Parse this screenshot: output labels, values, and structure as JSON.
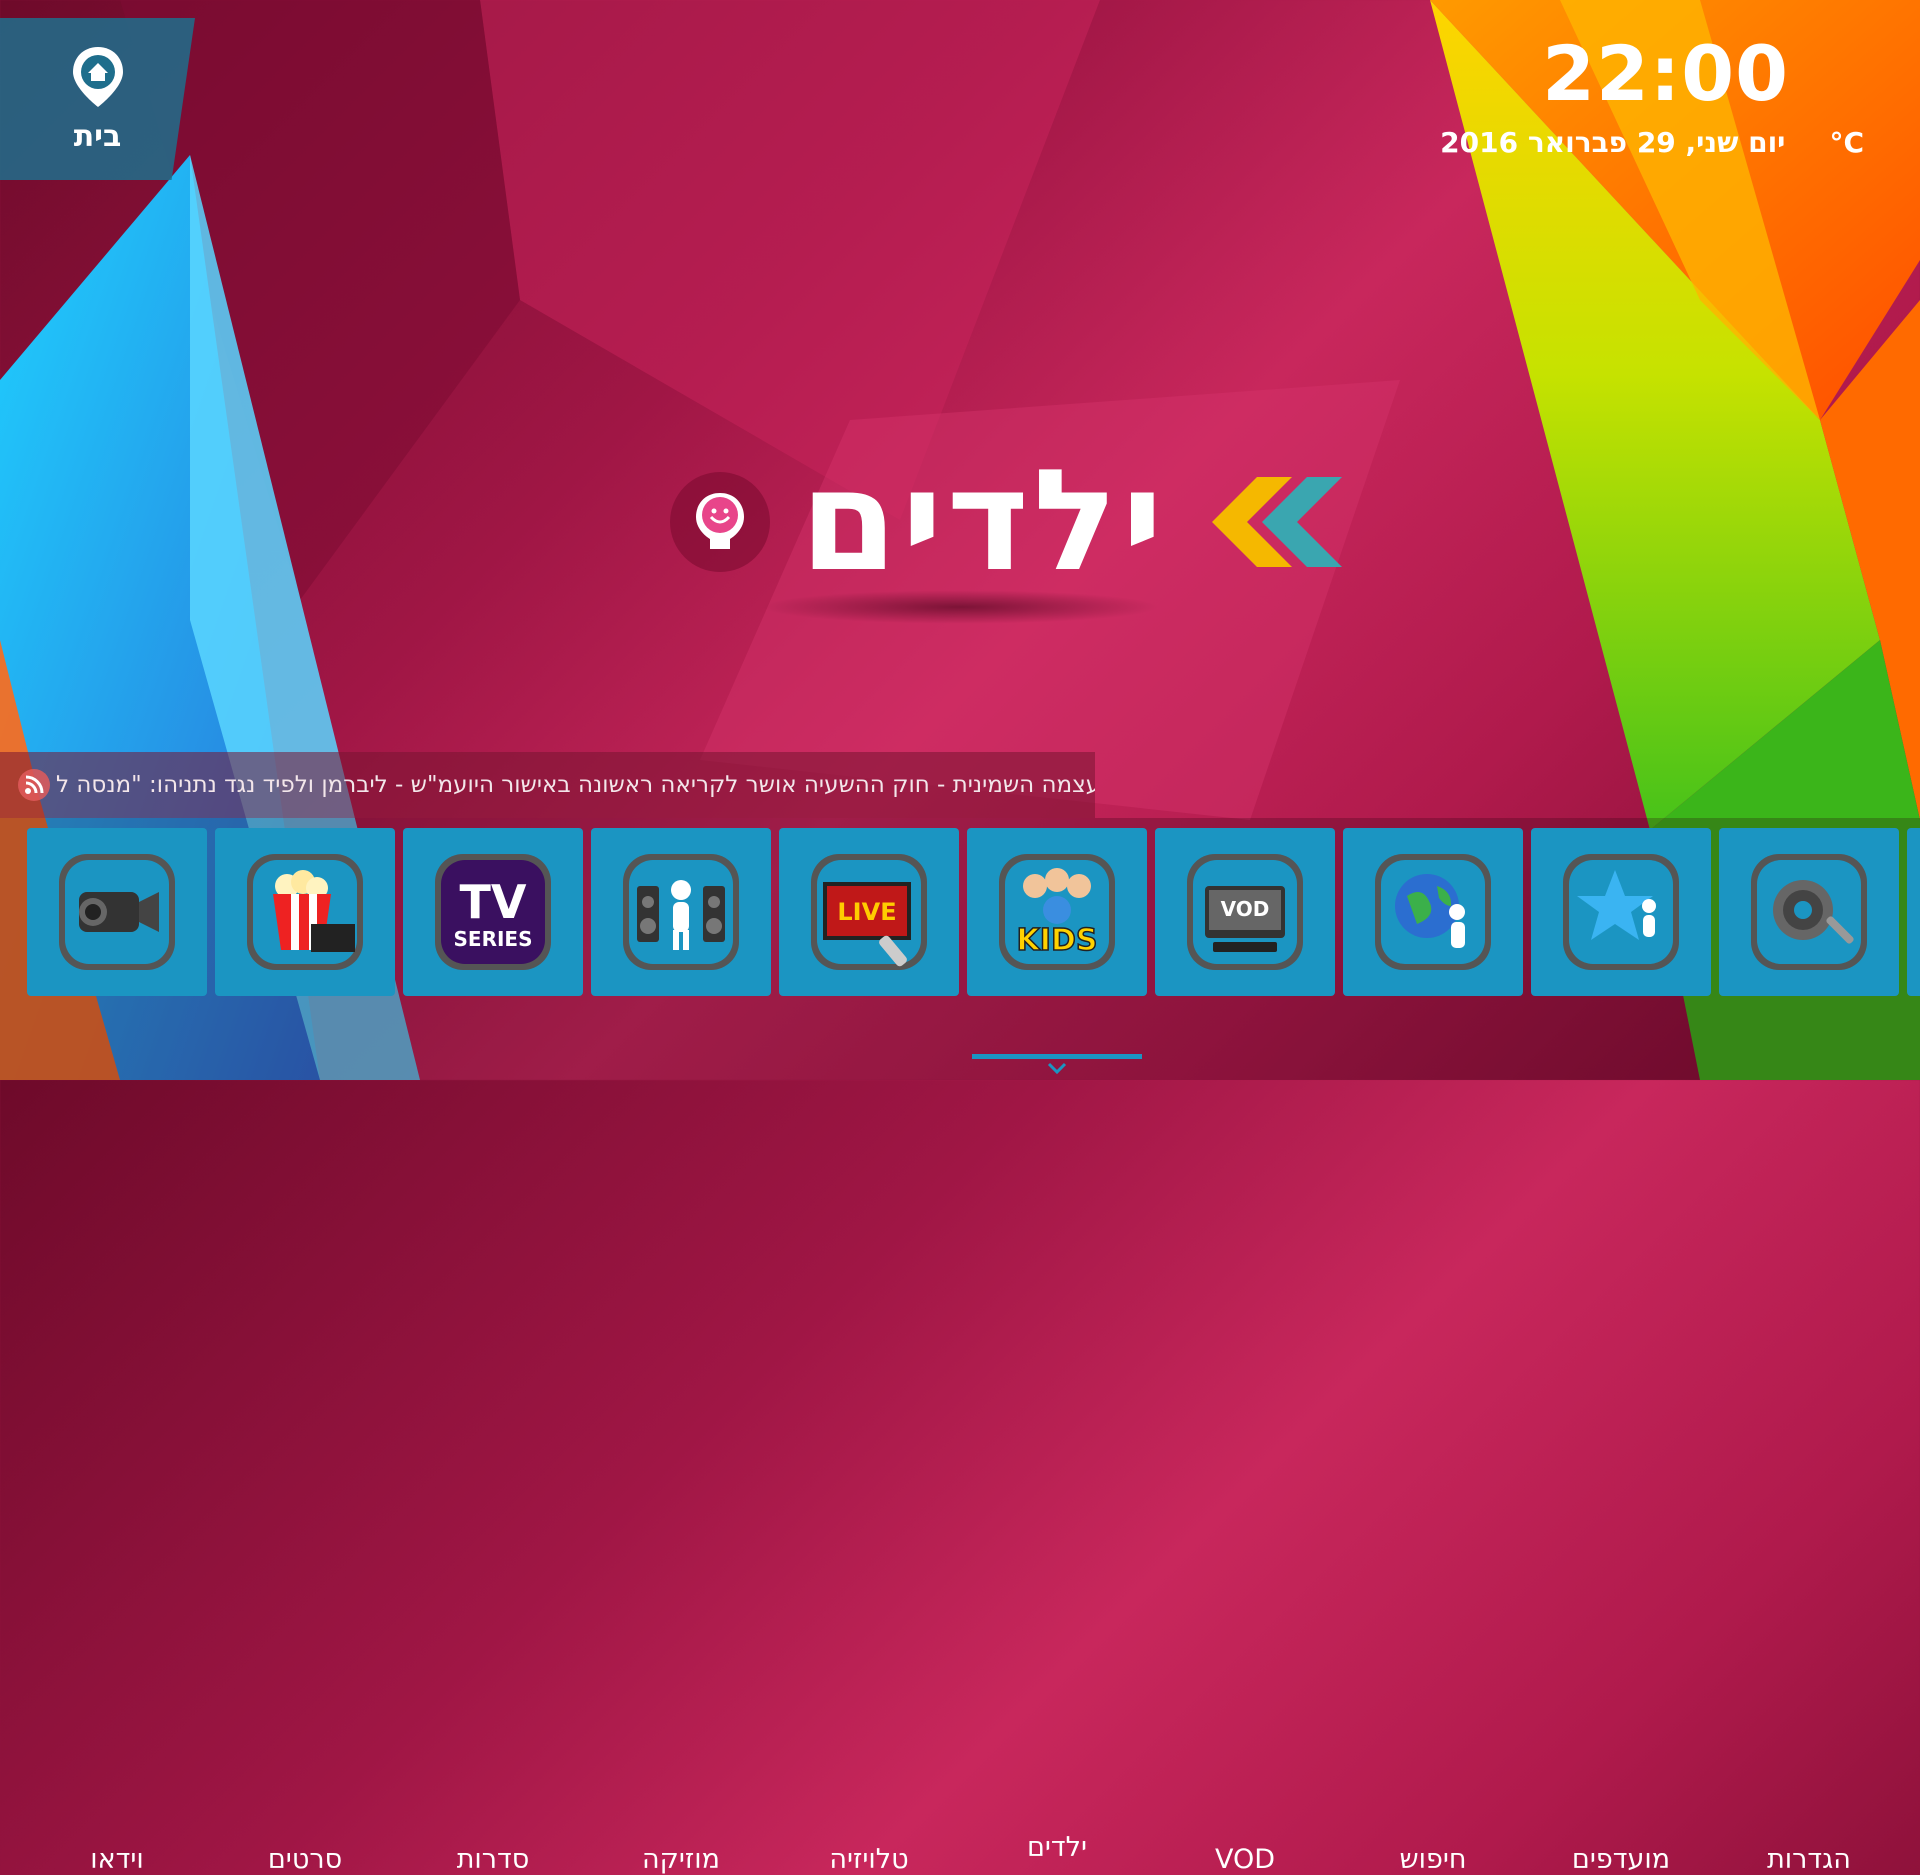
{
  "colors": {
    "tile_bg": "#1b95c2",
    "accent_yellow": "#f5b800",
    "accent_teal": "#3aa6b0",
    "background": "#b01a4c"
  },
  "home": {
    "label": "בית",
    "icon": "home-pin-icon"
  },
  "clock": {
    "time": "22:00",
    "date": "יום שני, 29 פברואר 2016",
    "temperature": "°C"
  },
  "hero": {
    "title": "ילדים",
    "icon": "kids-smiley-icon",
    "arrows": "chevron-left-icon"
  },
  "ticker": {
    "icon": "rss-icon",
    "text": "א המעצמה השמינית - חוק ההשעיה אושר לקריאה ראשונה באישור היועמ\"ש - ליברמן ולפיד נגד נתניהו: \"מנסה ל"
  },
  "menu": {
    "selected_index": 5,
    "items": [
      {
        "label": "וידאו",
        "icon": "video-camera-icon"
      },
      {
        "label": "סרטים",
        "icon": "popcorn-clapper-icon"
      },
      {
        "label": "סדרות",
        "icon": "tv-series-icon"
      },
      {
        "label": "מוזיקה",
        "icon": "music-speakers-icon"
      },
      {
        "label": "טלויזיה",
        "icon": "live-tv-icon"
      },
      {
        "label": "ילדים",
        "icon": "kids-icon"
      },
      {
        "label": "VOD",
        "icon": "vod-icon"
      },
      {
        "label": "חיפוש",
        "icon": "globe-search-icon"
      },
      {
        "label": "מועדפים",
        "icon": "favorites-star-icon"
      },
      {
        "label": "הגדרות",
        "icon": "settings-gear-icon"
      }
    ]
  }
}
